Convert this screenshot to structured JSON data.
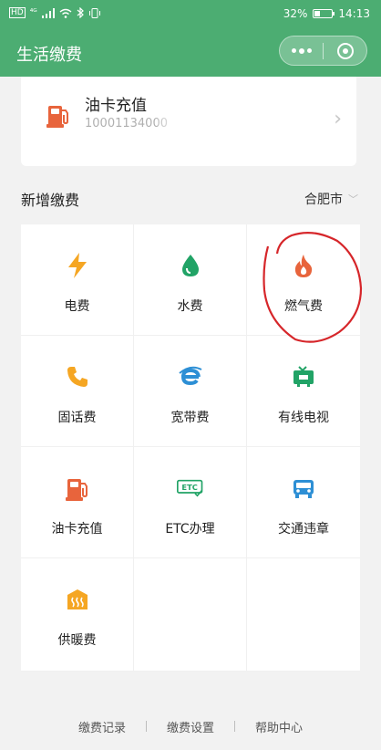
{
  "status_bar": {
    "left_icons": [
      "hd-icon",
      "signal-4g-icon",
      "signal-bars-icon",
      "wifi-icon",
      "bluetooth-icon",
      "vibrate-icon"
    ],
    "battery": "32%",
    "time": "14:13"
  },
  "navbar": {
    "title": "生活缴费",
    "bg_color": "#4cad72"
  },
  "oil_card": {
    "title": "油卡充值",
    "number": "10001134000"
  },
  "section": {
    "title": "新增缴费",
    "city": "合肥市"
  },
  "services": [
    {
      "label": "电费",
      "icon": "lightning-icon",
      "color": "#f5a623"
    },
    {
      "label": "水费",
      "icon": "water-drop-icon",
      "color": "#21a366"
    },
    {
      "label": "燃气费",
      "icon": "flame-icon",
      "color": "#e8643c"
    },
    {
      "label": "固话费",
      "icon": "phone-icon",
      "color": "#f5a623"
    },
    {
      "label": "宽带费",
      "icon": "broadband-e-icon",
      "color": "#2d8fd5"
    },
    {
      "label": "有线电视",
      "icon": "tv-icon",
      "color": "#21a366"
    },
    {
      "label": "油卡充值",
      "icon": "fuel-pump-icon",
      "color": "#e8643c"
    },
    {
      "label": "ETC办理",
      "icon": "etc-icon",
      "color": "#21a366"
    },
    {
      "label": "交通违章",
      "icon": "car-icon",
      "color": "#2d8fd5"
    },
    {
      "label": "供暖费",
      "icon": "heating-icon",
      "color": "#f5a623"
    }
  ],
  "footer": {
    "links": [
      "缴费记录",
      "缴费设置",
      "帮助中心"
    ]
  },
  "annotation_color": "#d6262a"
}
